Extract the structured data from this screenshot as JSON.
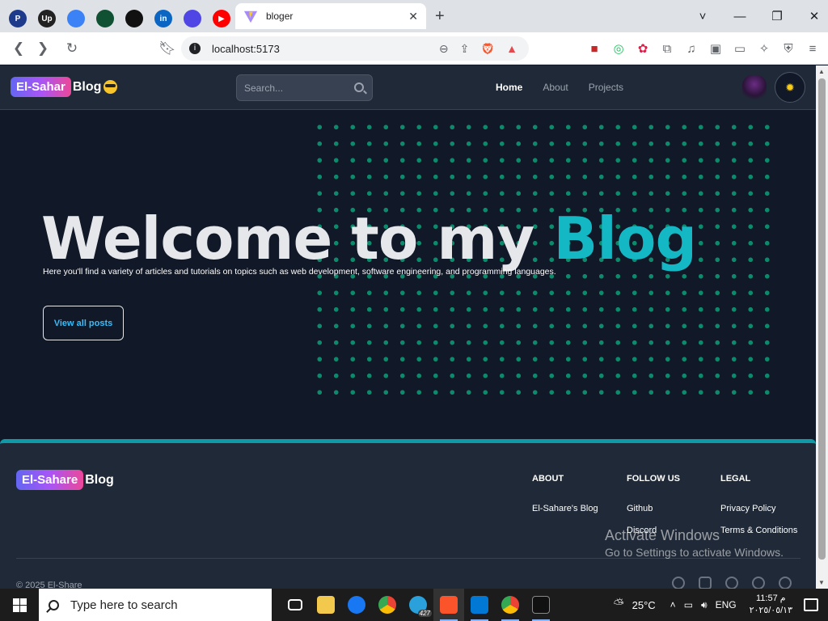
{
  "browser": {
    "pinned_tabs": [
      {
        "name": "paypal",
        "label": "P",
        "color": "#1e3a8a"
      },
      {
        "name": "upwork",
        "label": "Up",
        "color": "#222"
      },
      {
        "name": "tab-circle",
        "label": "",
        "color": "#3b82f6"
      },
      {
        "name": "mongodb",
        "label": "",
        "color": "#0f5132"
      },
      {
        "name": "github",
        "label": "",
        "color": "#111"
      },
      {
        "name": "linkedin",
        "label": "in",
        "color": "#0a66c2"
      },
      {
        "name": "tab-diamond",
        "label": "",
        "color": "#4f46e5"
      },
      {
        "name": "youtube",
        "label": "▶",
        "color": "#ff0000"
      }
    ],
    "active_tab_title": "bloger",
    "new_tab_label": "+",
    "address": "localhost:5173",
    "window_controls": [
      "˅",
      "—",
      "❐",
      "✕"
    ],
    "brave_badge": "1"
  },
  "site": {
    "brand_highlight": "El-Sahar",
    "brand_rest": "Blog",
    "search_placeholder": "Search...",
    "nav": [
      {
        "label": "Home",
        "active": true
      },
      {
        "label": "About",
        "active": false
      },
      {
        "label": "Projects",
        "active": false
      }
    ],
    "theme_icon": "sun-icon"
  },
  "hero": {
    "title_main": "Welcome to my",
    "title_accent": "Blog",
    "subtitle": "Here you'll find a variety of articles and tutorials on topics such as web development, software engineering, and programming languages.",
    "cta": "View all posts",
    "accent_color": "#14b8c4",
    "dots_color": "#0b8a6c"
  },
  "footer": {
    "brand_highlight": "El-Sahare",
    "brand_rest": "Blog",
    "columns": [
      {
        "title": "ABOUT",
        "links": [
          "El-Sahare's Blog"
        ]
      },
      {
        "title": "FOLLOW US",
        "links": [
          "Github",
          "Discord"
        ]
      },
      {
        "title": "LEGAL",
        "links": [
          "Privacy Policy",
          "Terms & Conditions"
        ]
      }
    ],
    "copyright": "© 2025 El-Share",
    "socials": [
      "facebook-icon",
      "instagram-icon",
      "twitter-icon",
      "github-icon",
      "dribbble-icon"
    ]
  },
  "watermark": {
    "line1": "Activate Windows",
    "line2": "Go to Settings to activate Windows."
  },
  "taskbar": {
    "search_placeholder": "Type here to search",
    "telegram_badge": "427",
    "temperature": "25°C",
    "language": "ENG",
    "time": "11:57 م",
    "date": "٢٠٢٥/٠٥/١٣"
  }
}
